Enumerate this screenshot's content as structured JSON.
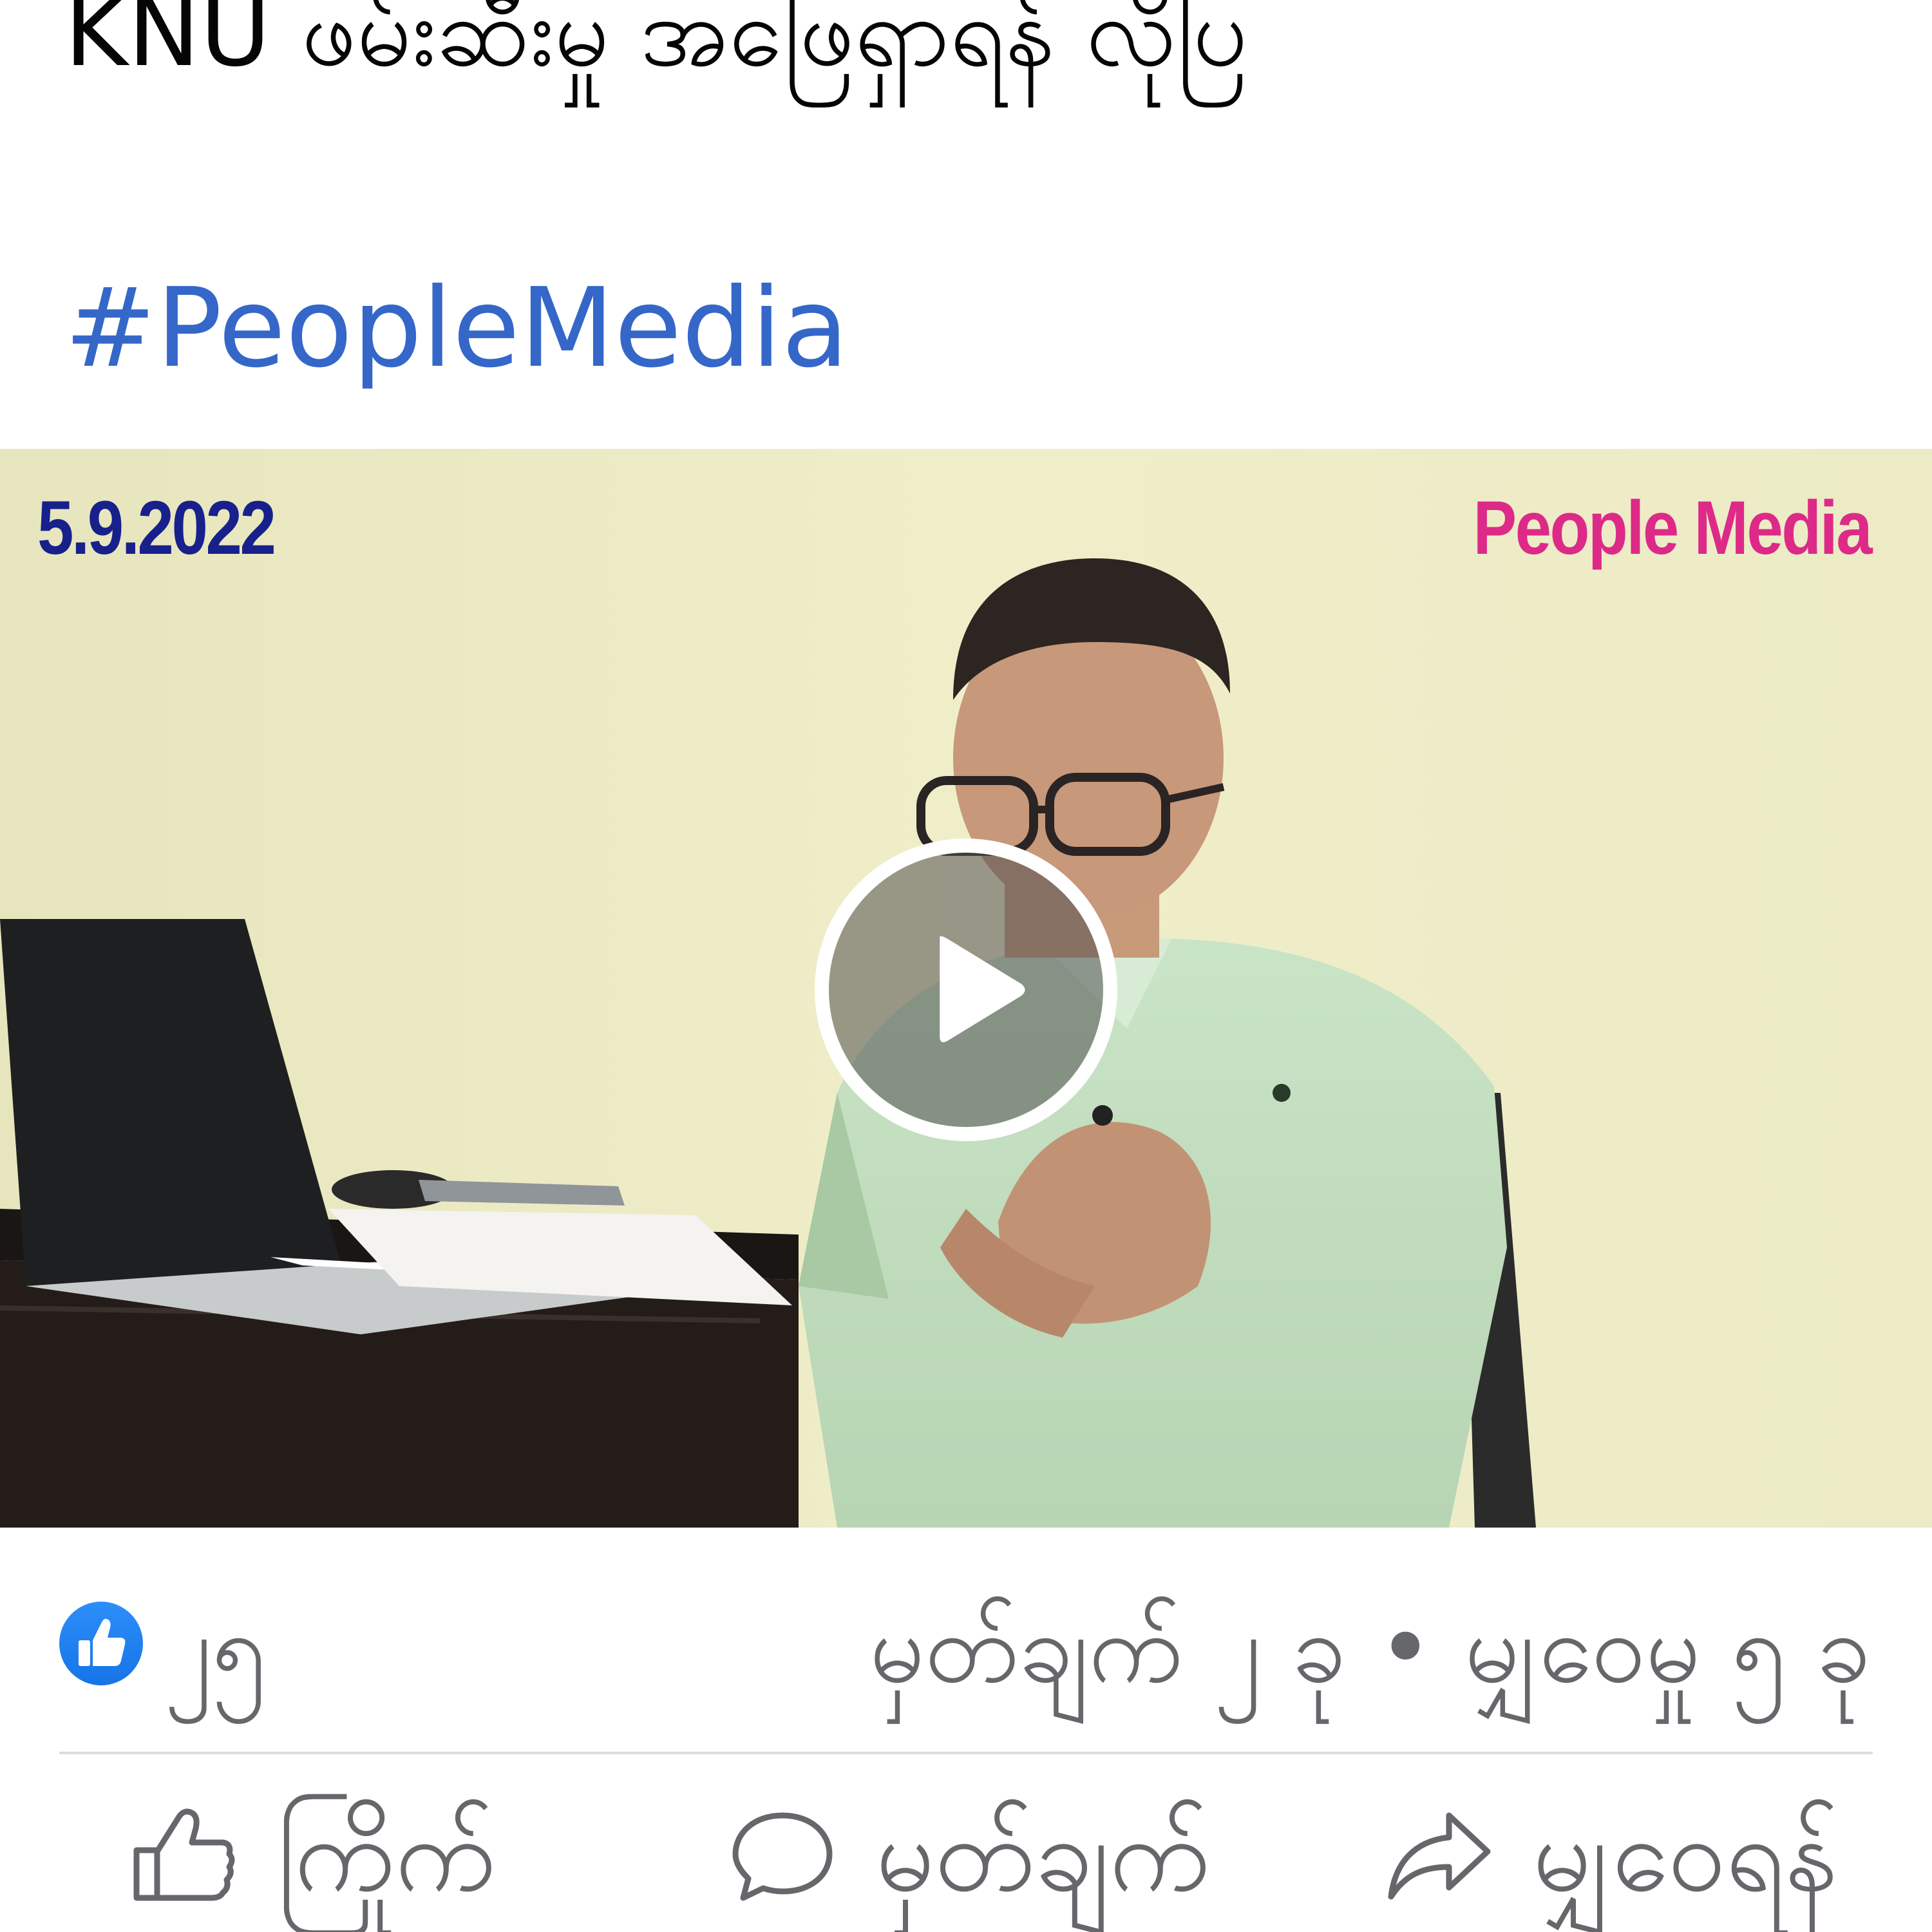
{
  "post": {
    "title": "KNU ဖမ်းဆီးမှု အဖြေရှာရန် လိုပြ",
    "hashtag": "#PeopleMedia"
  },
  "video": {
    "date_overlay": "5.9.2022",
    "brand_overlay": "People Media",
    "play_icon": "play-icon"
  },
  "stats": {
    "like_count": "၂၅",
    "comments_shares": "မှတ်ချက် ၂ ခု • မျှဝေမှု ၅ ခု",
    "reaction_icon": "like-reaction-icon"
  },
  "actions": {
    "like_label": "ကြိုက်",
    "comment_label": "မှတ်ချက်",
    "share_label": "မျှဝေရန်"
  },
  "colors": {
    "hashtag": "#3567c9",
    "date_overlay": "#18208c",
    "brand_overlay": "#dd2a88",
    "secondary_text": "#65676b",
    "like_badge": "#1877f2"
  }
}
